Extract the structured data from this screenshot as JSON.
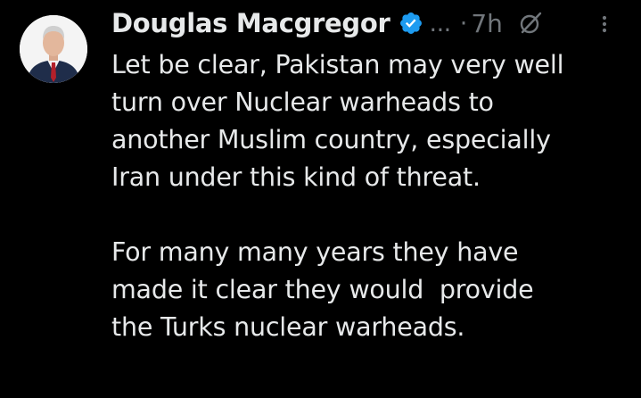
{
  "tweet": {
    "author_name": "Douglas Macgregor",
    "handle": "...",
    "separator": "·",
    "time": "7h",
    "paragraphs": [
      "Let be clear, Pakistan may very well\nturn over Nuclear warheads to\nanother Muslim country, especially\nIran under this kind of threat.",
      "For many many years they have\nmade it clear they would  provide\nthe Turks nuclear warheads."
    ]
  },
  "icons": {
    "verified": "verified-badge-icon",
    "grok": "grok-icon",
    "more": "more-options-icon"
  },
  "colors": {
    "background": "#000000",
    "text": "#e7e9ea",
    "muted": "#71767b",
    "verified": "#1d9bf0"
  }
}
